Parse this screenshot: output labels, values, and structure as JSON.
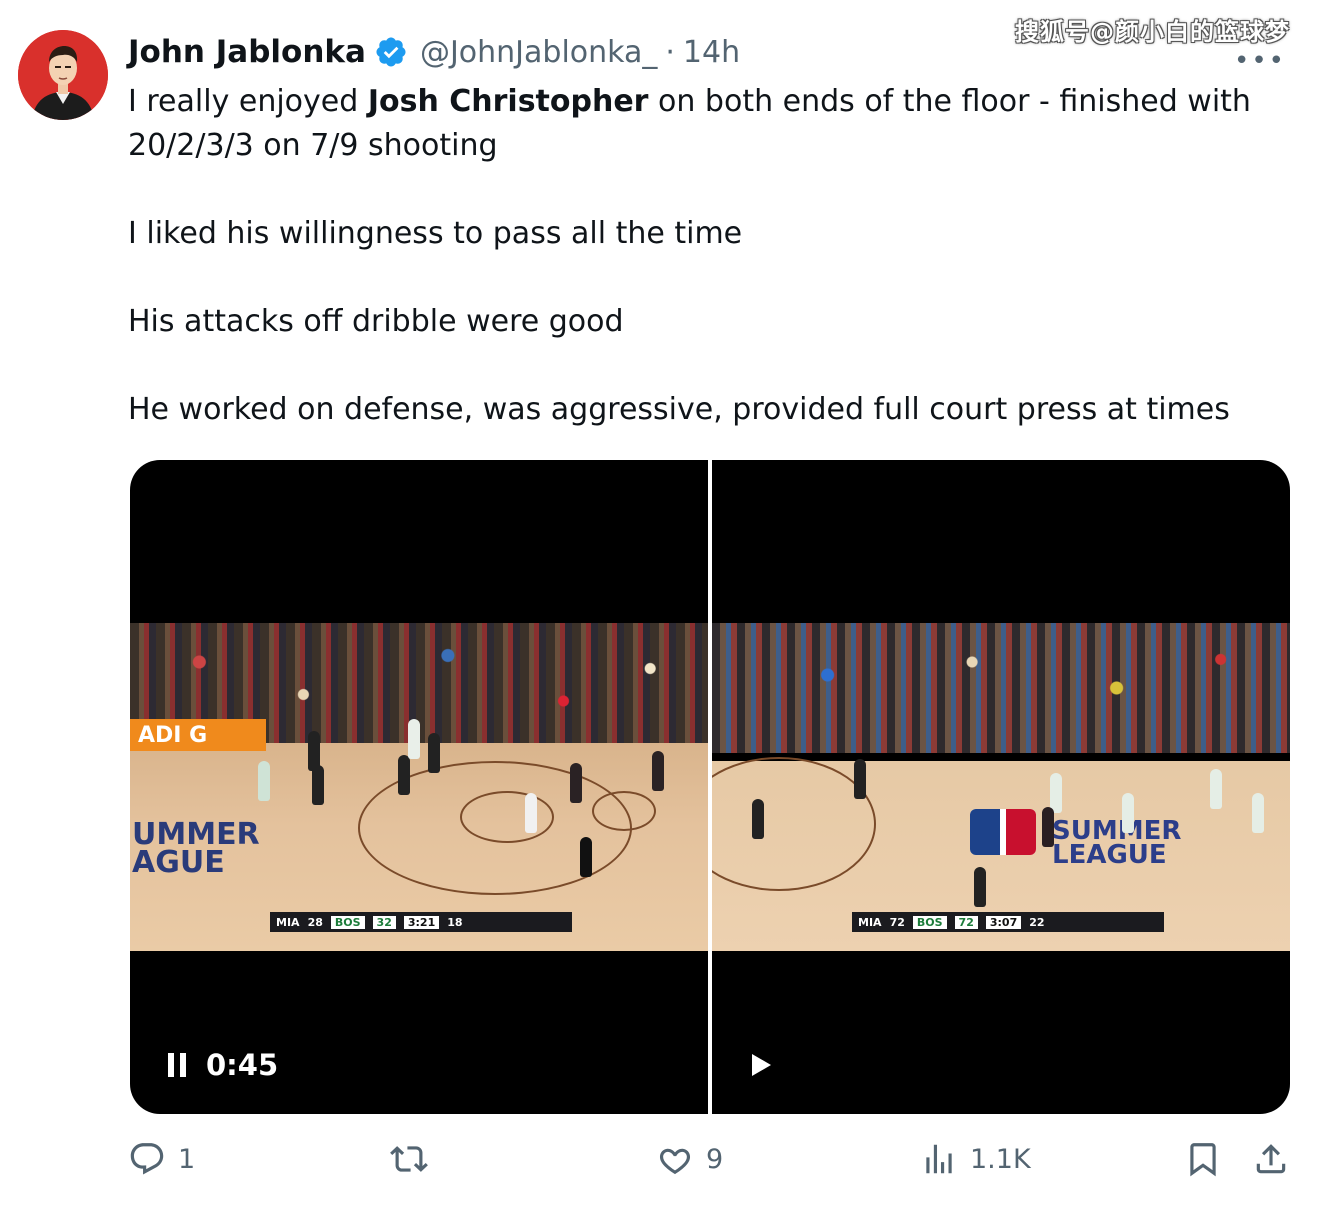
{
  "watermark": "搜狐号@颜小白的篮球梦",
  "author": {
    "name": "John Jablonka",
    "handle": "@JohnJablonka_",
    "separator": "·",
    "time": "14h"
  },
  "more_label": "•••",
  "tweet": {
    "line1_pre": "I really enjoyed ",
    "line1_bold": "Josh Christopher",
    "line1_post": " on both ends of the floor - finished with 20/2/3/3 on 7/9 shooting",
    "line2": "I liked his willingness to pass all the time",
    "line3": "His attacks off dribble were good",
    "line4": "He worked on defense, was aggressive, provided full court press at times"
  },
  "media": {
    "left": {
      "time": "0:45",
      "state": "playing",
      "adboard": "ADI    G",
      "logo": "UMMER\nAGUE",
      "score": {
        "team1": "MIA",
        "score1": "28",
        "team2": "BOS",
        "score2": "32",
        "clock": "3:21",
        "extra": "18"
      }
    },
    "right": {
      "state": "paused",
      "logo": "SUMMER\nLEAGUE",
      "score": {
        "team1": "MIA",
        "score1": "72",
        "team2": "BOS",
        "score2": "72",
        "clock": "3:07",
        "extra": "22"
      }
    }
  },
  "actions": {
    "reply_count": "1",
    "like_count": "9",
    "views_count": "1.1K"
  },
  "colors": {
    "text": "#0f1419",
    "secondary": "#536471",
    "verified": "#1d9bf0",
    "avatar_bg": "#d9302c"
  }
}
